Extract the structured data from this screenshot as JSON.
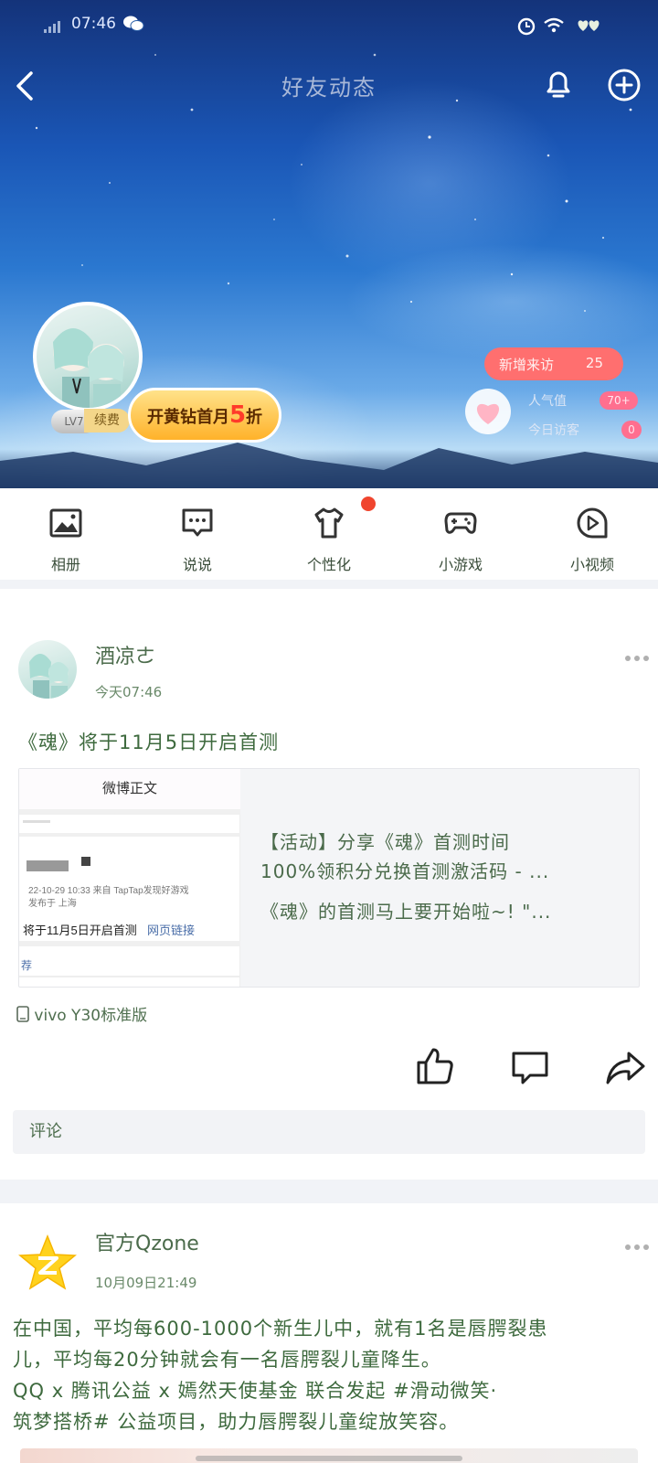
{
  "status_bar": {
    "time": "07:46"
  },
  "header": {
    "title": "好友动态"
  },
  "profile": {
    "level": "LV7",
    "renew": "续费",
    "vip_promo": {
      "prefix": "开黄钻首月",
      "highlight": "5",
      "suffix": "折"
    },
    "new_visitors_label": "新增来访",
    "new_visitors_count": "25",
    "popularity_label": "人气值",
    "popularity_value": "70+",
    "today_visitors_label": "今日访客",
    "today_visitors_value": "0"
  },
  "nav": [
    {
      "label": "相册",
      "icon": "album-icon"
    },
    {
      "label": "说说",
      "icon": "chat-bubble-icon"
    },
    {
      "label": "个性化",
      "icon": "tshirt-icon"
    },
    {
      "label": "小游戏",
      "icon": "gamepad-icon"
    },
    {
      "label": "小视频",
      "icon": "video-play-icon"
    }
  ],
  "post1": {
    "author": "酒凉ㄜ",
    "time": "今天07:46",
    "text": "《魂》将于11月5日开启首测",
    "card": {
      "thumb_title": "微博正文",
      "thumb_meta1": "22-10-29 10:33  来自 TapTap发现好游戏",
      "thumb_meta2": "发布于 上海",
      "thumb_main": "将于11月5日开启首测",
      "thumb_link": "网页链接",
      "thumb_rec": "荐",
      "line1": "【活动】分享《魂》首测时间",
      "line2": "100%领积分兑换首测激活码 - ...",
      "line3": "《魂》的首测马上要开始啦~!    \"..."
    },
    "device": "vivo Y30标准版",
    "comment_placeholder": "评论"
  },
  "post2": {
    "author": "官方Qzone",
    "time": "10月09日21:49",
    "lines": [
      "在中国，平均每600-1000个新生儿中，就有1名是唇腭裂患",
      "儿，平均每20分钟就会有一名唇腭裂儿童降生。",
      "QQ x 腾讯公益 x 嫣然天使基金 联合发起 #滑动微笑·",
      "筑梦搭桥# 公益项目，助力唇腭裂儿童绽放笑容。"
    ]
  },
  "colors": {
    "accent_red": "#f0452e",
    "vip_gold": "#ffb22a",
    "visitor_pink": "#ff6f6f",
    "text_green": "#3e6a3e"
  }
}
